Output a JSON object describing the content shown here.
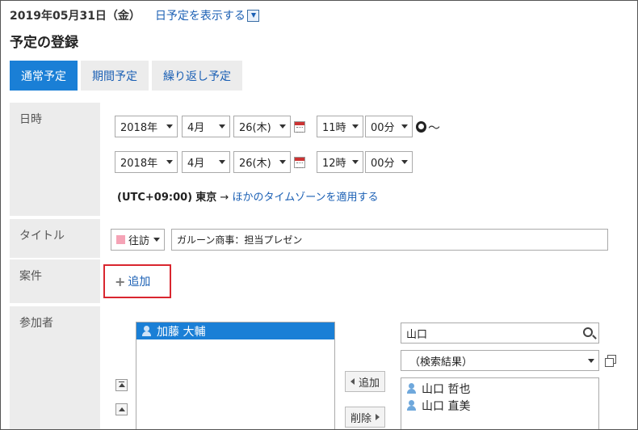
{
  "header": {
    "date": "2019年05月31日（金）",
    "show_day_link": "日予定を表示する"
  },
  "page_title": "予定の登録",
  "tabs": [
    {
      "label": "通常予定",
      "active": true
    },
    {
      "label": "期間予定",
      "active": false
    },
    {
      "label": "繰り返し予定",
      "active": false
    }
  ],
  "datetime": {
    "label": "日時",
    "start": {
      "year": "2018年",
      "month": "4月",
      "day": "26(木)",
      "hour": "11時",
      "minute": "00分"
    },
    "end": {
      "year": "2018年",
      "month": "4月",
      "day": "26(木)",
      "hour": "12時",
      "minute": "00分"
    },
    "tilde": "～",
    "timezone_prefix": "(UTC+09:00)",
    "timezone_city": "東京",
    "timezone_arrow": "→",
    "timezone_link": "ほかのタイムゾーンを適用する"
  },
  "title_row": {
    "label": "タイトル",
    "menu_value": "往訪",
    "menu_color": "#f5a3b6",
    "title_value": "ガルーン商事：担当プレゼン"
  },
  "case_row": {
    "label": "案件",
    "add_label": "追加"
  },
  "participants": {
    "label": "参加者",
    "selected_list": [
      "加藤 大輔"
    ],
    "search_value": "山口",
    "filter_value": "（検索結果）",
    "add_button": "追加",
    "remove_button": "削除",
    "candidates": [
      "山口 哲也",
      "山口 直美"
    ]
  },
  "colors": {
    "accent": "#1a7fd6",
    "link": "#1a5fb4",
    "highlight": "#d9262f"
  }
}
